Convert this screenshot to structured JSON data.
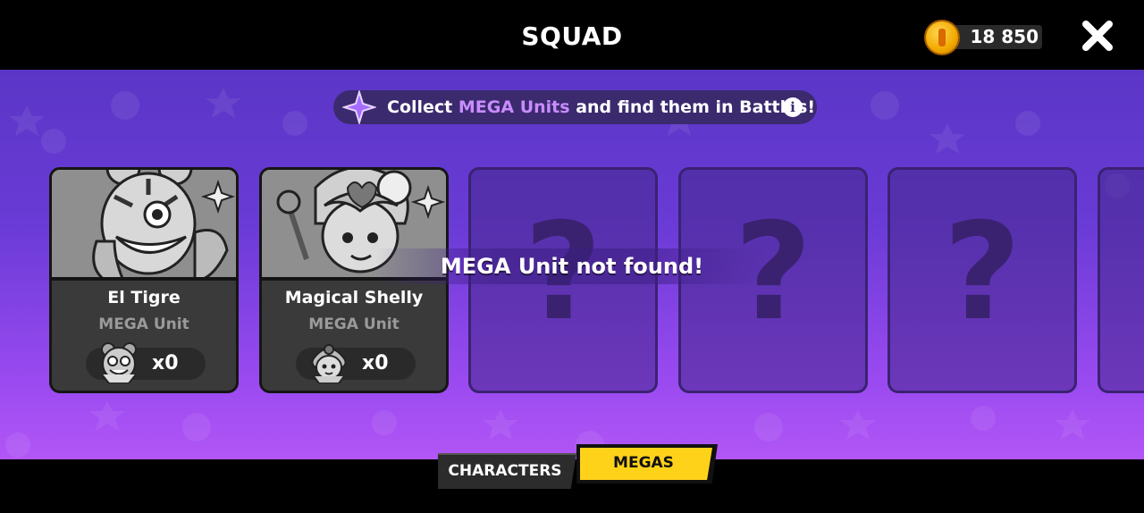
{
  "header": {
    "title": "SQUAD",
    "coins": "18 850"
  },
  "banner": {
    "text_before": "Collect",
    "highlight": "MEGA Units",
    "text_after": "and find them in Battles!",
    "info": "i"
  },
  "units": [
    {
      "name": "El Tigre",
      "type": "MEGA Unit",
      "count": "x0"
    },
    {
      "name": "Magical Shelly",
      "type": "MEGA Unit",
      "count": "x0"
    }
  ],
  "locked_cards": [
    {
      "symbol": "?"
    },
    {
      "symbol": "?"
    },
    {
      "symbol": "?"
    }
  ],
  "message": "MEGA Unit not found!",
  "tabs": [
    {
      "label": "CHARACTERS",
      "active": false
    },
    {
      "label": "MEGAS",
      "active": true
    }
  ],
  "colors": {
    "accent_purple": "#c98cff",
    "active_tab": "#ffd21a",
    "coin": "#f2a900",
    "background_top": "#5a36c6",
    "background_bottom": "#b256f6"
  },
  "icons": [
    "coin-icon",
    "close-icon",
    "mega-star-icon",
    "info-icon",
    "el-tigre-token-icon",
    "magical-shelly-token-icon"
  ]
}
